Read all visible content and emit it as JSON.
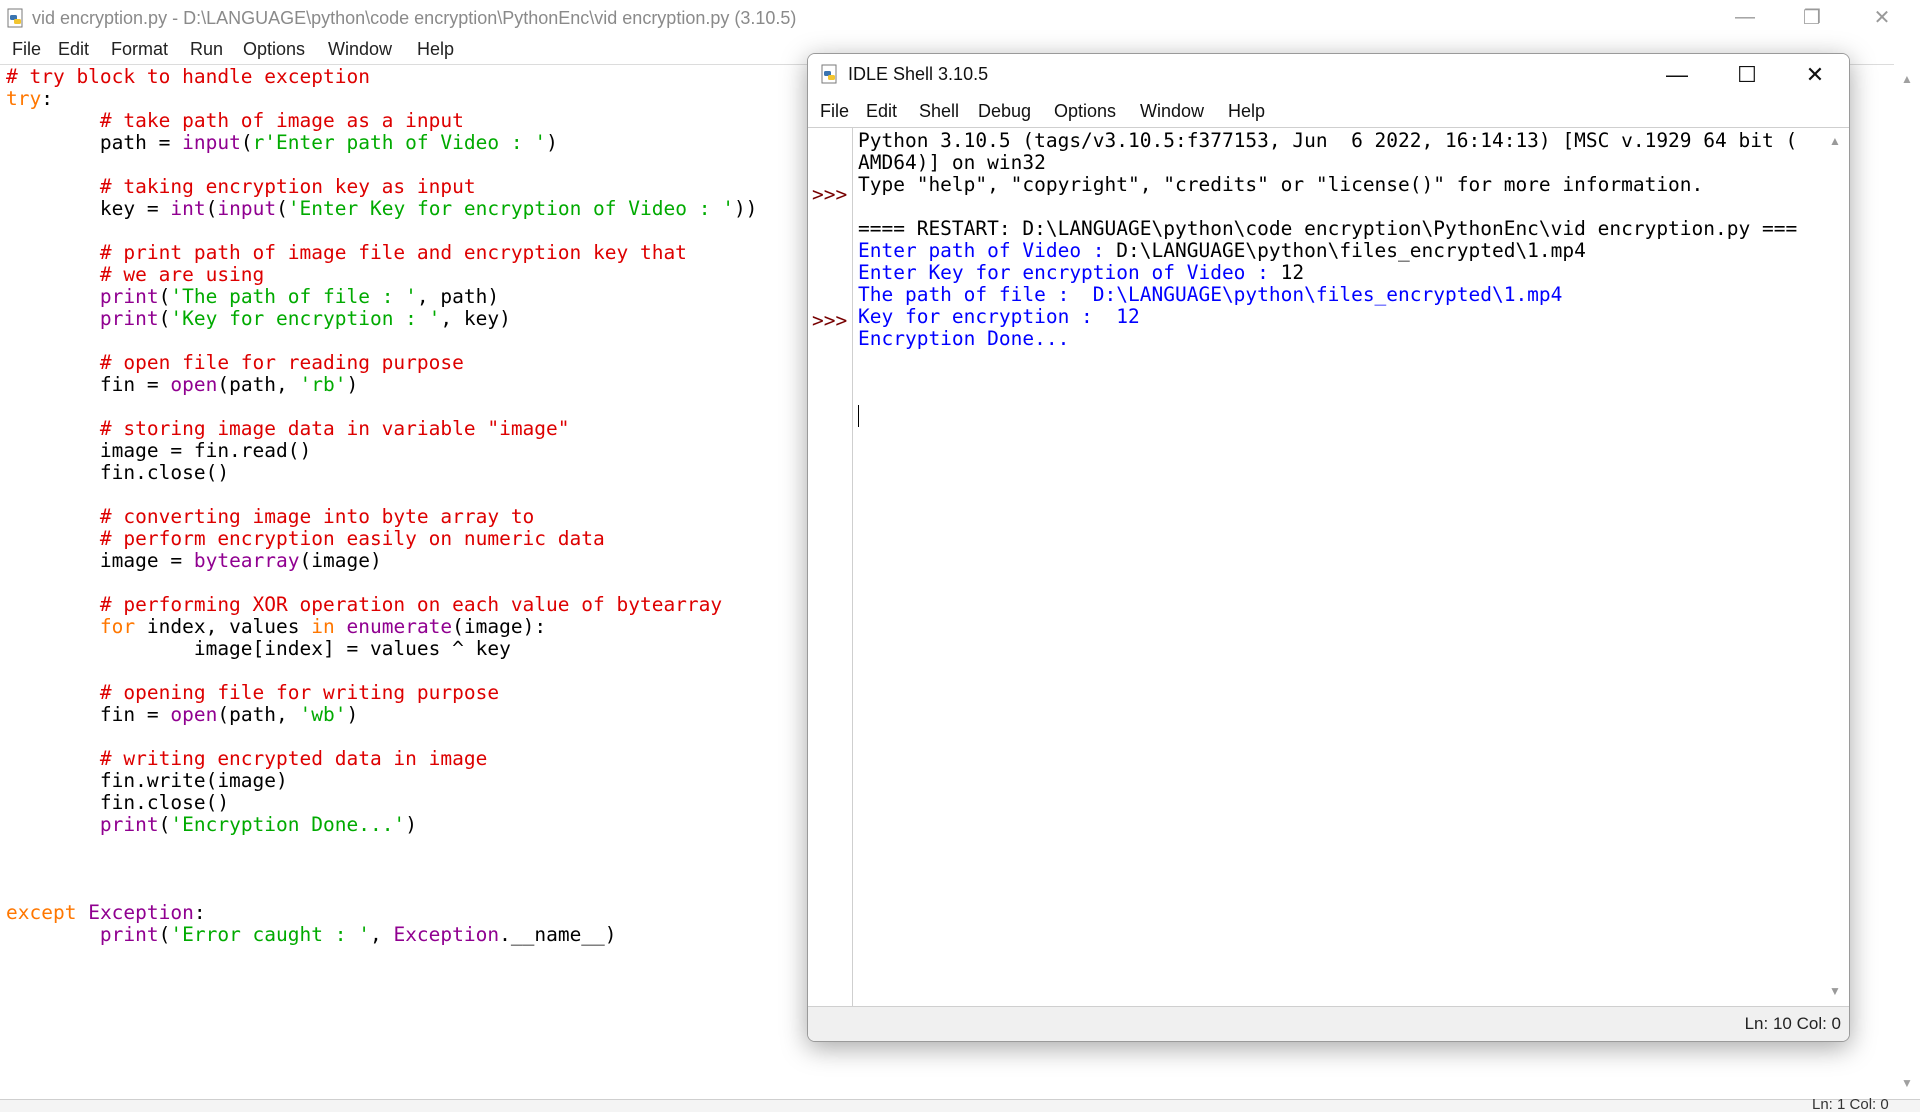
{
  "editor": {
    "title": "vid encryption.py - D:\\LANGUAGE\\python\\code encryption\\PythonEnc\\vid encryption.py (3.10.5)",
    "menu": [
      "File",
      "Edit",
      "Format",
      "Run",
      "Options",
      "Window",
      "Help"
    ],
    "code": [
      [
        [
          "c-comment",
          "# try block to handle exception"
        ]
      ],
      [
        [
          "c-keyword",
          "try"
        ],
        [
          "c-normal",
          ":"
        ]
      ],
      [
        [
          "c-comment",
          "        # take path of image as a input"
        ]
      ],
      [
        [
          "c-normal",
          "        path = "
        ],
        [
          "c-builtin",
          "input"
        ],
        [
          "c-normal",
          "("
        ],
        [
          "c-string",
          "r'Enter path of Video : '"
        ],
        [
          "c-normal",
          ")"
        ]
      ],
      [],
      [
        [
          "c-comment",
          "        # taking encryption key as input"
        ]
      ],
      [
        [
          "c-normal",
          "        key = "
        ],
        [
          "c-builtin",
          "int"
        ],
        [
          "c-normal",
          "("
        ],
        [
          "c-builtin",
          "input"
        ],
        [
          "c-normal",
          "("
        ],
        [
          "c-string",
          "'Enter Key for encryption of Video : '"
        ],
        [
          "c-normal",
          "))"
        ]
      ],
      [],
      [
        [
          "c-comment",
          "        # print path of image file and encryption key that"
        ]
      ],
      [
        [
          "c-comment",
          "        # we are using"
        ]
      ],
      [
        [
          "c-normal",
          "        "
        ],
        [
          "c-builtin",
          "print"
        ],
        [
          "c-normal",
          "("
        ],
        [
          "c-string",
          "'The path of file : '"
        ],
        [
          "c-normal",
          ", path)"
        ]
      ],
      [
        [
          "c-normal",
          "        "
        ],
        [
          "c-builtin",
          "print"
        ],
        [
          "c-normal",
          "("
        ],
        [
          "c-string",
          "'Key for encryption : '"
        ],
        [
          "c-normal",
          ", key)"
        ]
      ],
      [],
      [
        [
          "c-comment",
          "        # open file for reading purpose"
        ]
      ],
      [
        [
          "c-normal",
          "        fin = "
        ],
        [
          "c-builtin",
          "open"
        ],
        [
          "c-normal",
          "(path, "
        ],
        [
          "c-string",
          "'rb'"
        ],
        [
          "c-normal",
          ")"
        ]
      ],
      [],
      [
        [
          "c-comment",
          "        # storing image data in variable \"image\""
        ]
      ],
      [
        [
          "c-normal",
          "        image = fin.read()"
        ]
      ],
      [
        [
          "c-normal",
          "        fin.close()"
        ]
      ],
      [],
      [
        [
          "c-comment",
          "        # converting image into byte array to"
        ]
      ],
      [
        [
          "c-comment",
          "        # perform encryption easily on numeric data"
        ]
      ],
      [
        [
          "c-normal",
          "        image = "
        ],
        [
          "c-builtin",
          "bytearray"
        ],
        [
          "c-normal",
          "(image)"
        ]
      ],
      [],
      [
        [
          "c-comment",
          "        # performing XOR operation on each value of bytearray"
        ]
      ],
      [
        [
          "c-normal",
          "        "
        ],
        [
          "c-keyword",
          "for"
        ],
        [
          "c-normal",
          " index, values "
        ],
        [
          "c-keyword",
          "in"
        ],
        [
          "c-normal",
          " "
        ],
        [
          "c-builtin",
          "enumerate"
        ],
        [
          "c-normal",
          "(image):"
        ]
      ],
      [
        [
          "c-normal",
          "                image[index] = values ^ key"
        ]
      ],
      [],
      [
        [
          "c-comment",
          "        # opening file for writing purpose"
        ]
      ],
      [
        [
          "c-normal",
          "        fin = "
        ],
        [
          "c-builtin",
          "open"
        ],
        [
          "c-normal",
          "(path, "
        ],
        [
          "c-string",
          "'wb'"
        ],
        [
          "c-normal",
          ")"
        ]
      ],
      [],
      [
        [
          "c-comment",
          "        # writing encrypted data in image"
        ]
      ],
      [
        [
          "c-normal",
          "        fin.write(image)"
        ]
      ],
      [
        [
          "c-normal",
          "        fin.close()"
        ]
      ],
      [
        [
          "c-normal",
          "        "
        ],
        [
          "c-builtin",
          "print"
        ],
        [
          "c-normal",
          "("
        ],
        [
          "c-string",
          "'Encryption Done...'"
        ],
        [
          "c-normal",
          ")"
        ]
      ],
      [],
      [],
      [],
      [
        [
          "c-keyword",
          "except"
        ],
        [
          "c-normal",
          " "
        ],
        [
          "c-builtin",
          "Exception"
        ],
        [
          "c-normal",
          ":"
        ]
      ],
      [
        [
          "c-normal",
          "        "
        ],
        [
          "c-builtin",
          "print"
        ],
        [
          "c-normal",
          "("
        ],
        [
          "c-string",
          "'Error caught : '"
        ],
        [
          "c-normal",
          ", "
        ],
        [
          "c-builtin",
          "Exception"
        ],
        [
          "c-normal",
          ".__name__)"
        ]
      ]
    ],
    "status": "Ln: 1  Col: 0"
  },
  "shell": {
    "title": "IDLE Shell 3.10.5",
    "menu": [
      "File",
      "Edit",
      "Shell",
      "Debug",
      "Options",
      "Window",
      "Help"
    ],
    "prompt": ">>>",
    "lines": [
      [
        "s-out",
        "Python 3.10.5 (tags/v3.10.5:f377153, Jun  6 2022, 16:14:13) [MSC v.1929 64 bit ("
      ],
      [
        "s-out",
        "AMD64)] on win32"
      ],
      [
        "s-out",
        "Type \"help\", \"copyright\", \"credits\" or \"license()\" for more information."
      ],
      [
        "s-out",
        ""
      ],
      [
        "s-out",
        "==== RESTART: D:\\LANGUAGE\\python\\code encryption\\PythonEnc\\vid encryption.py ==="
      ],
      [
        "s-stdout",
        "Enter path of Video : "
      ],
      [
        "s-stdout",
        "Enter Key for encryption of Video : "
      ],
      [
        "s-stdout",
        "The path of file :  D:\\LANGUAGE\\python\\files_encrypted\\1.mp4"
      ],
      [
        "s-stdout",
        "Key for encryption :  12"
      ],
      [
        "s-stdout",
        "Encryption Done..."
      ]
    ],
    "input_path": "D:\\LANGUAGE\\python\\files_encrypted\\1.mp4",
    "input_key": "12",
    "status": "Ln: 10   Col: 0"
  }
}
